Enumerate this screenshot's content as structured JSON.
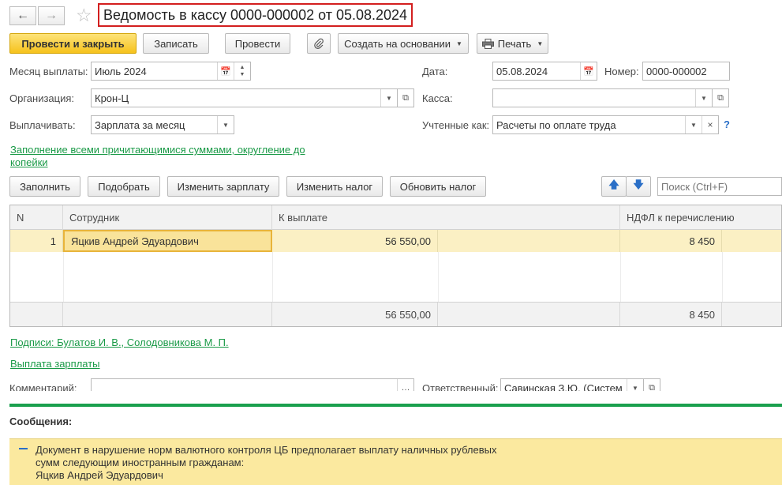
{
  "header": {
    "title": "Ведомость в кассу 0000-000002 от 05.08.2024",
    "back_icon": "arrow-left-icon",
    "forward_icon": "arrow-right-icon",
    "favorite_icon": "star-icon"
  },
  "toolbar": {
    "post_close": "Провести и закрыть",
    "save": "Записать",
    "post": "Провести",
    "attach_icon": "paperclip-icon",
    "create_basis": "Создать на основании",
    "print": "Печать"
  },
  "form": {
    "month_label": "Месяц выплаты:",
    "month_value": "Июль 2024",
    "date_label": "Дата:",
    "date_value": "05.08.2024",
    "number_label": "Номер:",
    "number_value": "0000-000002",
    "org_label": "Организация:",
    "org_value": "Крон-Ц",
    "kassa_label": "Касса:",
    "kassa_value": "",
    "pay_label": "Выплачивать:",
    "pay_value": "Зарплата за месяц",
    "accounted_label": "Учтенные как:",
    "accounted_value": "Расчеты по оплате труда",
    "help": "?"
  },
  "fill_link": {
    "line1": "Заполнение всеми причитающимися суммами, округление до",
    "line2": "копейки"
  },
  "table_toolbar": {
    "fill": "Заполнить",
    "select": "Подобрать",
    "change_salary": "Изменить зарплату",
    "change_tax": "Изменить налог",
    "refresh_tax": "Обновить налог",
    "search_placeholder": "Поиск (Ctrl+F)"
  },
  "table": {
    "columns": [
      "N",
      "Сотрудник",
      "К выплате",
      "НДФЛ к перечислению"
    ],
    "rows": [
      {
        "n": "1",
        "employee": "Яцкив Андрей Эдуардович",
        "payout": "56 550,00",
        "ndfl": "8 450"
      }
    ],
    "totals": {
      "payout": "56 550,00",
      "ndfl": "8 450"
    }
  },
  "signatures_link": "Подписи: Булатов И. В., Солодовникова М. П.",
  "salary_link": "Выплата зарплаты",
  "bottom": {
    "comment_label": "Комментарий:",
    "comment_value": "",
    "responsible_label": "Ответственный:",
    "responsible_value": "Савинская З.Ю. (Систем"
  },
  "messages": {
    "title": "Сообщения:",
    "text_line1": "Документ в нарушение норм валютного контроля ЦБ предполагает выплату наличных рублевых",
    "text_line2": "сумм следующим иностранным гражданам:",
    "text_line3": "Яцкив Андрей Эдуардович"
  },
  "colors": {
    "primary_button": "#f6c21c",
    "link": "#1a9a47",
    "title_border": "#d31f1f",
    "selected_row": "#fbf0c4",
    "message_bg": "#fbe99f"
  }
}
